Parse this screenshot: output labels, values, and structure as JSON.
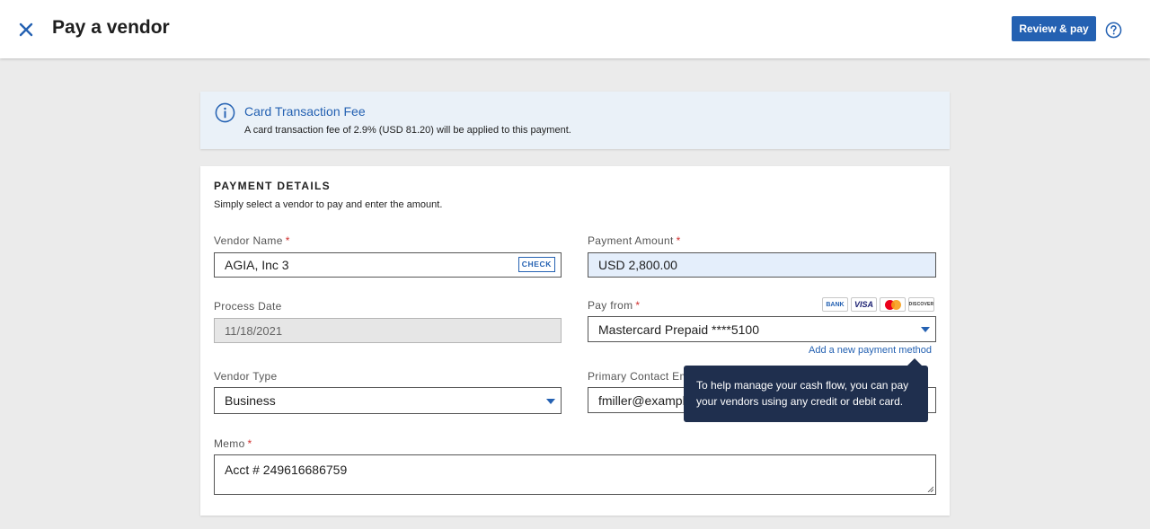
{
  "header": {
    "title": "Pay a vendor",
    "review_button": "Review & pay"
  },
  "info_banner": {
    "title": "Card Transaction Fee",
    "text": "A card transaction fee of 2.9% (USD 81.20) will be applied to this payment."
  },
  "payment_details": {
    "heading": "PAYMENT DETAILS",
    "subtitle": "Simply select a vendor to pay and enter the amount.",
    "vendor_name": {
      "label": "Vendor Name",
      "value": "AGIA, Inc 3",
      "badge": "CHECK"
    },
    "payment_amount": {
      "label": "Payment Amount",
      "value": "USD 2,800.00"
    },
    "process_date": {
      "label": "Process Date",
      "value": "11/18/2021"
    },
    "pay_from": {
      "label": "Pay from",
      "value": "Mastercard Prepaid ****5100",
      "logos": {
        "bank": "BANK",
        "visa": "VISA",
        "discover": "DISCOVER"
      },
      "add_link": "Add a new payment method"
    },
    "vendor_type": {
      "label": "Vendor Type",
      "value": "Business"
    },
    "primary_contact": {
      "label": "Primary Contact Em",
      "value": "fmiller@example"
    },
    "memo": {
      "label": "Memo",
      "value": "Acct # 249616686759"
    },
    "required_marker": "*"
  },
  "tooltip": {
    "text": "To help manage your cash flow, you can pay your vendors using any credit or debit card."
  },
  "colors": {
    "accent": "#2461b2",
    "required": "#d0302f",
    "tooltip_bg": "#1f2f4e",
    "info_bg": "#eaf1f8"
  },
  "icons": {
    "close": "close-icon",
    "help": "help-icon",
    "info": "info-icon",
    "caret": "chevron-down-icon"
  }
}
